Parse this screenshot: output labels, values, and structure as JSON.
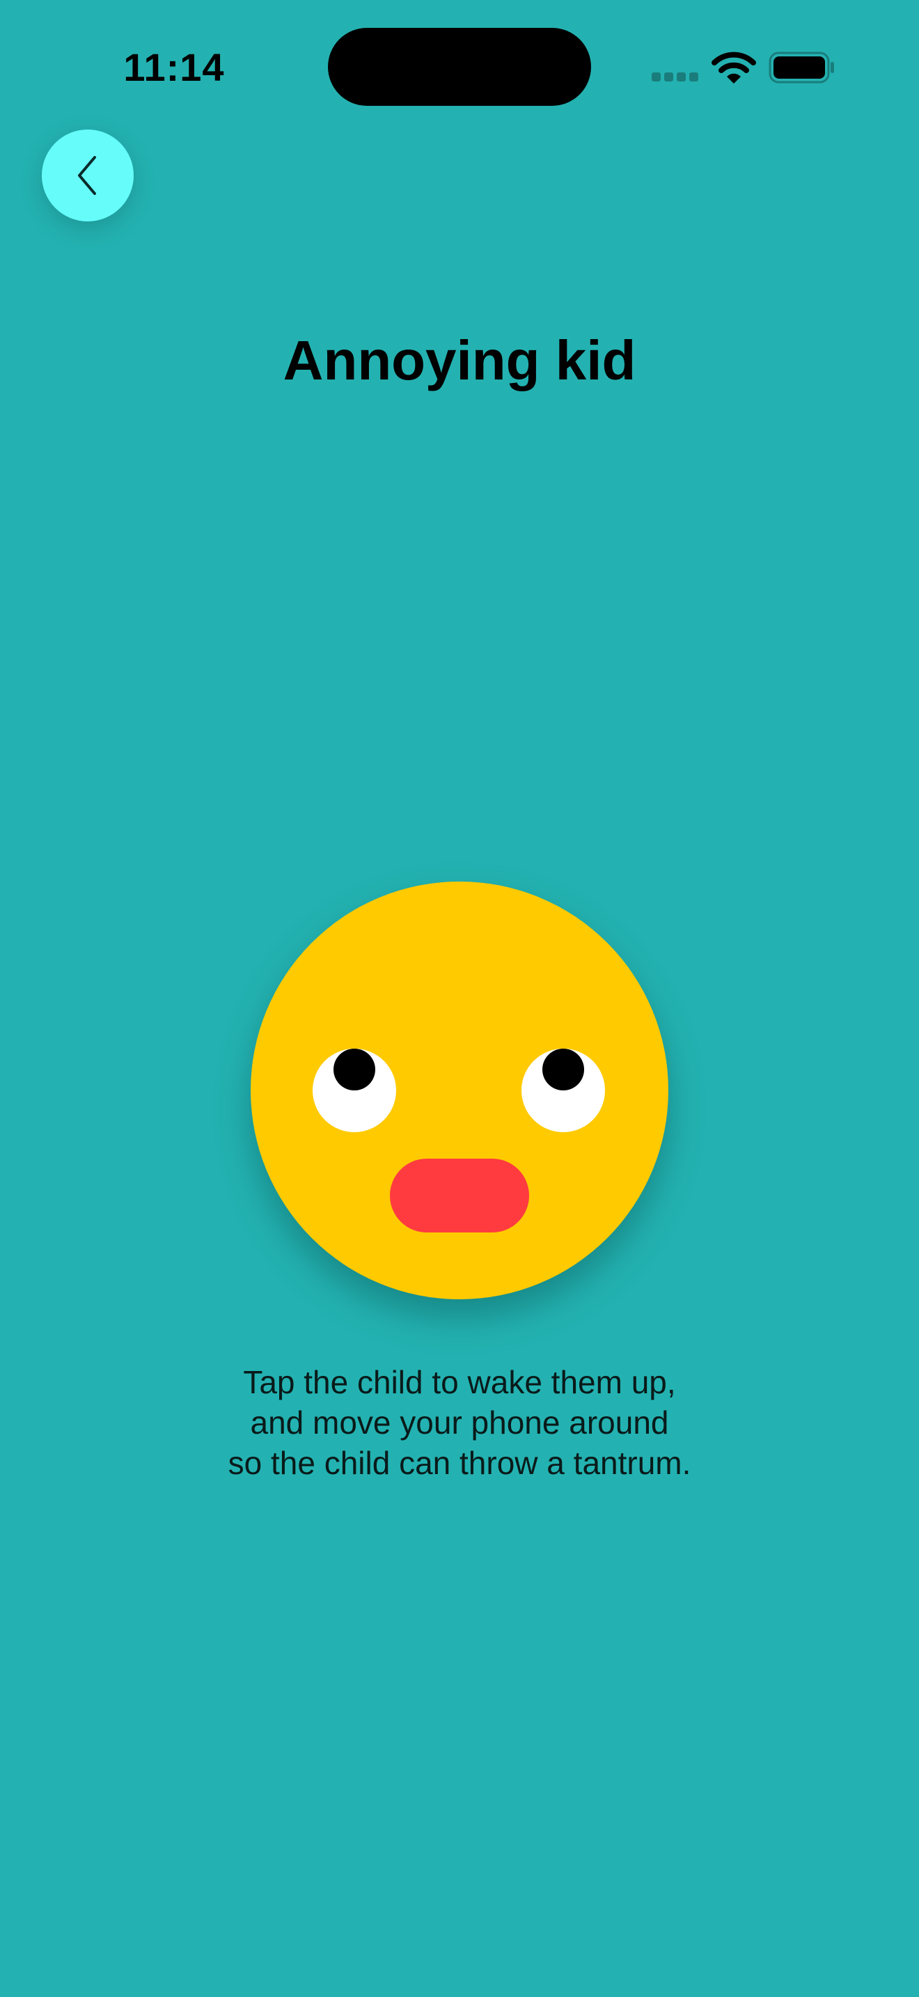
{
  "status_bar": {
    "time": "11:14",
    "icons": [
      "signal-icon",
      "wifi-icon",
      "battery-icon"
    ]
  },
  "nav": {
    "back_icon": "chevron-left-icon"
  },
  "title": "Annoying kid",
  "kid": {
    "face_color": "#ffca00",
    "eye_color": "#ffffff",
    "pupil_color": "#000000",
    "mouth_color": "#ff3b40"
  },
  "instructions": {
    "line1": "Tap the child to wake them up,",
    "line2": "and move your phone around",
    "line3": "so the child can throw a tantrum."
  },
  "colors": {
    "background": "#23b2b1",
    "back_button": "#66fcfa"
  }
}
